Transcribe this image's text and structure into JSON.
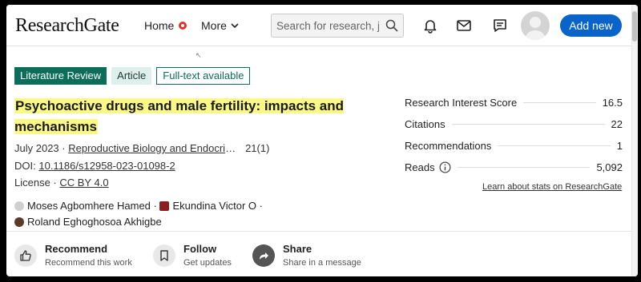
{
  "header": {
    "logo": "ResearchGate",
    "home_label": "Home",
    "more_label": "More",
    "search_placeholder": "Search for research, journals, people",
    "add_new_label": "Add new"
  },
  "tags": {
    "literature_review": "Literature Review",
    "article": "Article",
    "full_text": "Full-text available"
  },
  "article": {
    "title": "Psychoactive drugs and male fertility: impacts and mechanisms",
    "date": "July 2023 ·",
    "journal": "Reproductive Biology and Endocrinology",
    "issue": "21(1)",
    "doi_label": "DOI:",
    "doi": "10.1186/s12958-023-01098-2",
    "license_label": "License ·",
    "license": "CC BY 4.0"
  },
  "authors": [
    {
      "name": "Moses Agbomhere Hamed ·"
    },
    {
      "name": "Ekundina Victor O ·"
    },
    {
      "name": "Roland Eghoghosoa Akhigbe"
    }
  ],
  "stats": {
    "research_interest_label": "Research Interest Score",
    "research_interest_value": "16.5",
    "citations_label": "Citations",
    "citations_value": "22",
    "recommendations_label": "Recommendations",
    "recommendations_value": "1",
    "reads_label": "Reads",
    "reads_value": "5,092",
    "learn_more": "Learn about stats on ResearchGate"
  },
  "actions": {
    "recommend_label": "Recommend",
    "recommend_sub": "Recommend this work",
    "follow_label": "Follow",
    "follow_sub": "Get updates",
    "share_label": "Share",
    "share_sub": "Share in a message"
  },
  "colors": {
    "brand_green": "#0c6e58",
    "button_blue": "#0a63c9",
    "title_highlight": "#fbf986"
  }
}
